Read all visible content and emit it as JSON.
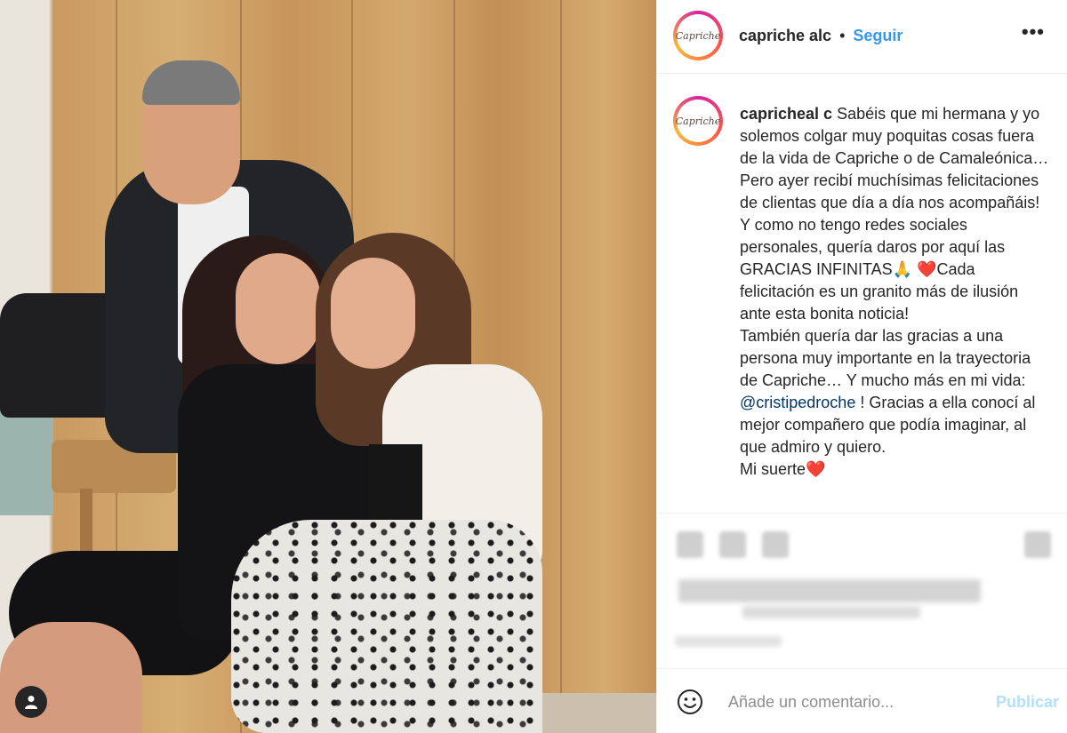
{
  "post": {
    "username": "capriche alc",
    "avatar_text": "Capriche",
    "follow_label": "Seguir",
    "more_label": "•••",
    "separator_dot": "•"
  },
  "caption": {
    "username": "capricheal c",
    "text_before": " Sabéis que mi hermana y yo solemos colgar muy poquitas cosas fuera de la vida de Capriche o de Camaleónica… Pero ayer recibí muchísimas felicitaciones de clientas que día a día nos acompañáis! Y como no tengo redes sociales personales, quería daros por aquí las GRACIAS INFINITAS🙏 ❤️Cada felicitación es un granito más de ilusión ante esta bonita noticia!\nTambién quería dar las gracias a una persona muy importante en la trayectoria de Capriche… Y mucho más en mi vida: ",
    "mention": "@cristipedroche",
    "text_after": " ! Gracias a ella conocí al mejor compañero que podía imaginar, al que admiro y quiero.\nMi suerte❤️"
  },
  "comment": {
    "placeholder": "Añade un comentario...",
    "publish_label": "Publicar"
  },
  "colors": {
    "follow": "#3897f0",
    "publish_disabled": "#b2dffc",
    "mention": "#00376b"
  },
  "icons": {
    "more": "more-options-icon",
    "smile": "emoji-icon",
    "user_tag": "user-tag-icon"
  }
}
